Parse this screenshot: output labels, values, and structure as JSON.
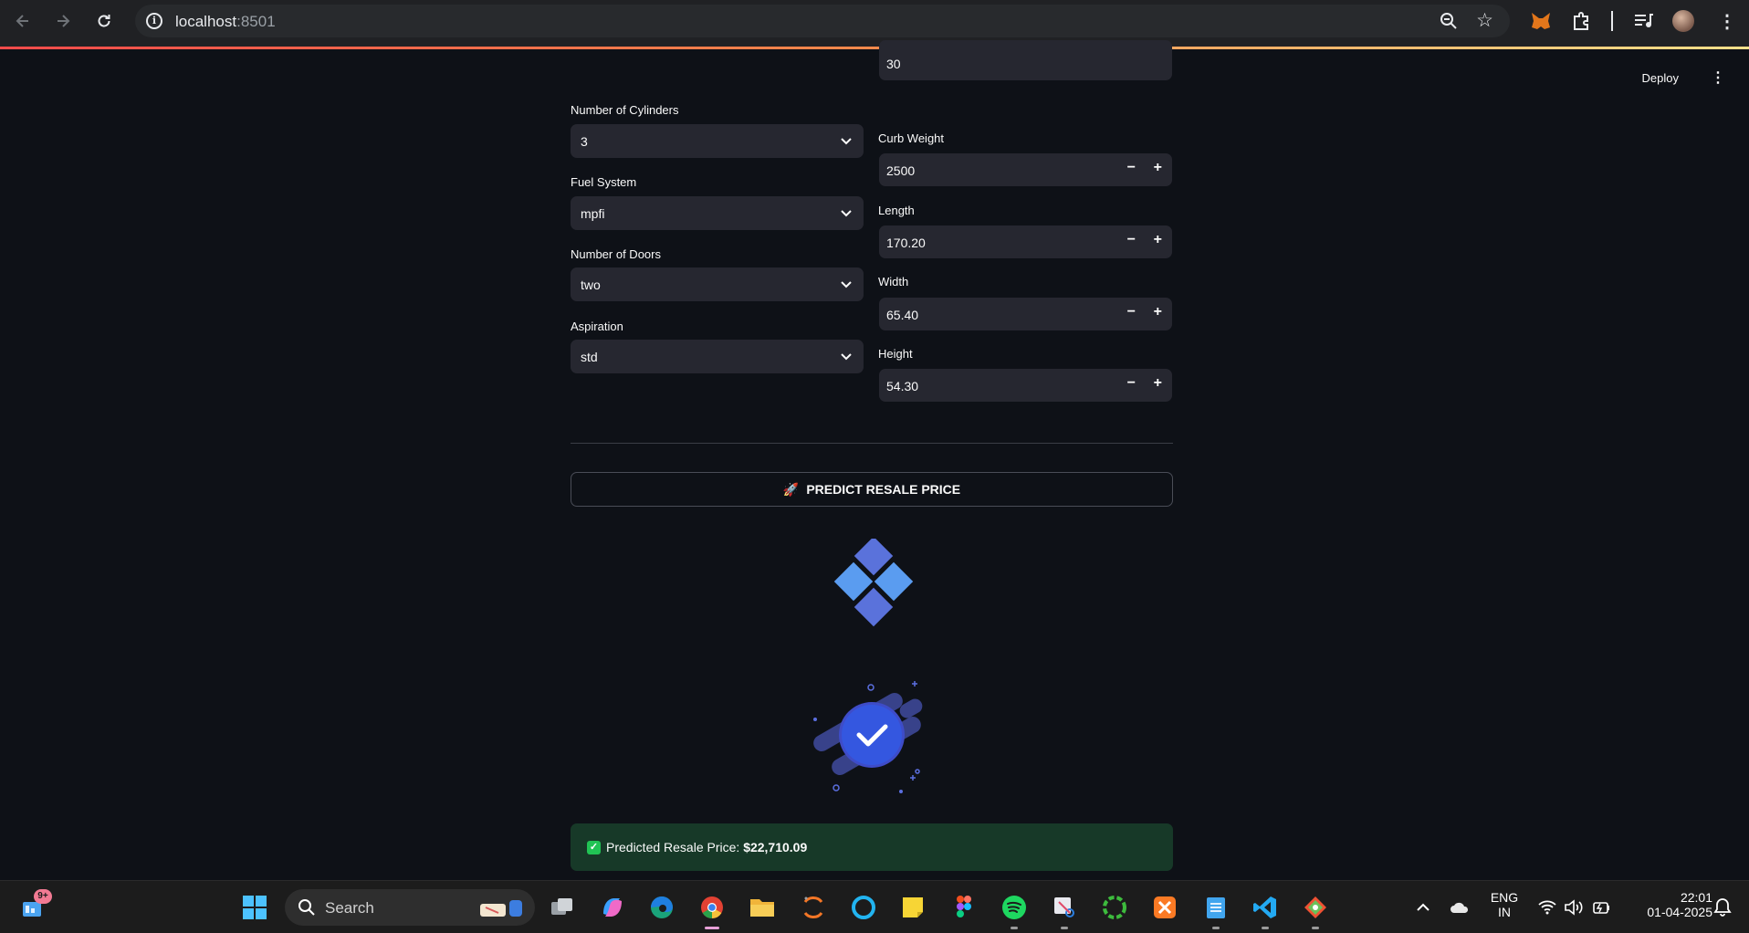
{
  "browser": {
    "url_host": "localhost",
    "url_port": ":8501"
  },
  "header": {
    "deploy_label": "Deploy"
  },
  "left_column": {
    "cylinders": {
      "label": "Number of Cylinders",
      "value": "3"
    },
    "fuel_system": {
      "label": "Fuel System",
      "value": "mpfi"
    },
    "doors": {
      "label": "Number of Doors",
      "value": "two"
    },
    "aspiration": {
      "label": "Aspiration",
      "value": "std"
    }
  },
  "right_column": {
    "partial_value": "30",
    "curb_weight": {
      "label": "Curb Weight",
      "value": "2500"
    },
    "length": {
      "label": "Length",
      "value": "170.20"
    },
    "width": {
      "label": "Width",
      "value": "65.40"
    },
    "height": {
      "label": "Height",
      "value": "54.30"
    }
  },
  "predict_button": {
    "icon": "🚀",
    "label": "PREDICT RESALE PRICE"
  },
  "result": {
    "prefix": "Predicted Resale Price: ",
    "price": "$22,710.09"
  },
  "taskbar": {
    "search_label": "Search",
    "widgets_badge": "9+",
    "lang_line1": "ENG",
    "lang_line2": "IN",
    "time": "22:01",
    "date": "01-04-2025"
  },
  "colors": {
    "app_bg": "#0e1117",
    "input_bg": "#262730",
    "success_bg": "#173928",
    "success_icon": "#21c354",
    "accent_blue": "#4d6bdb"
  }
}
